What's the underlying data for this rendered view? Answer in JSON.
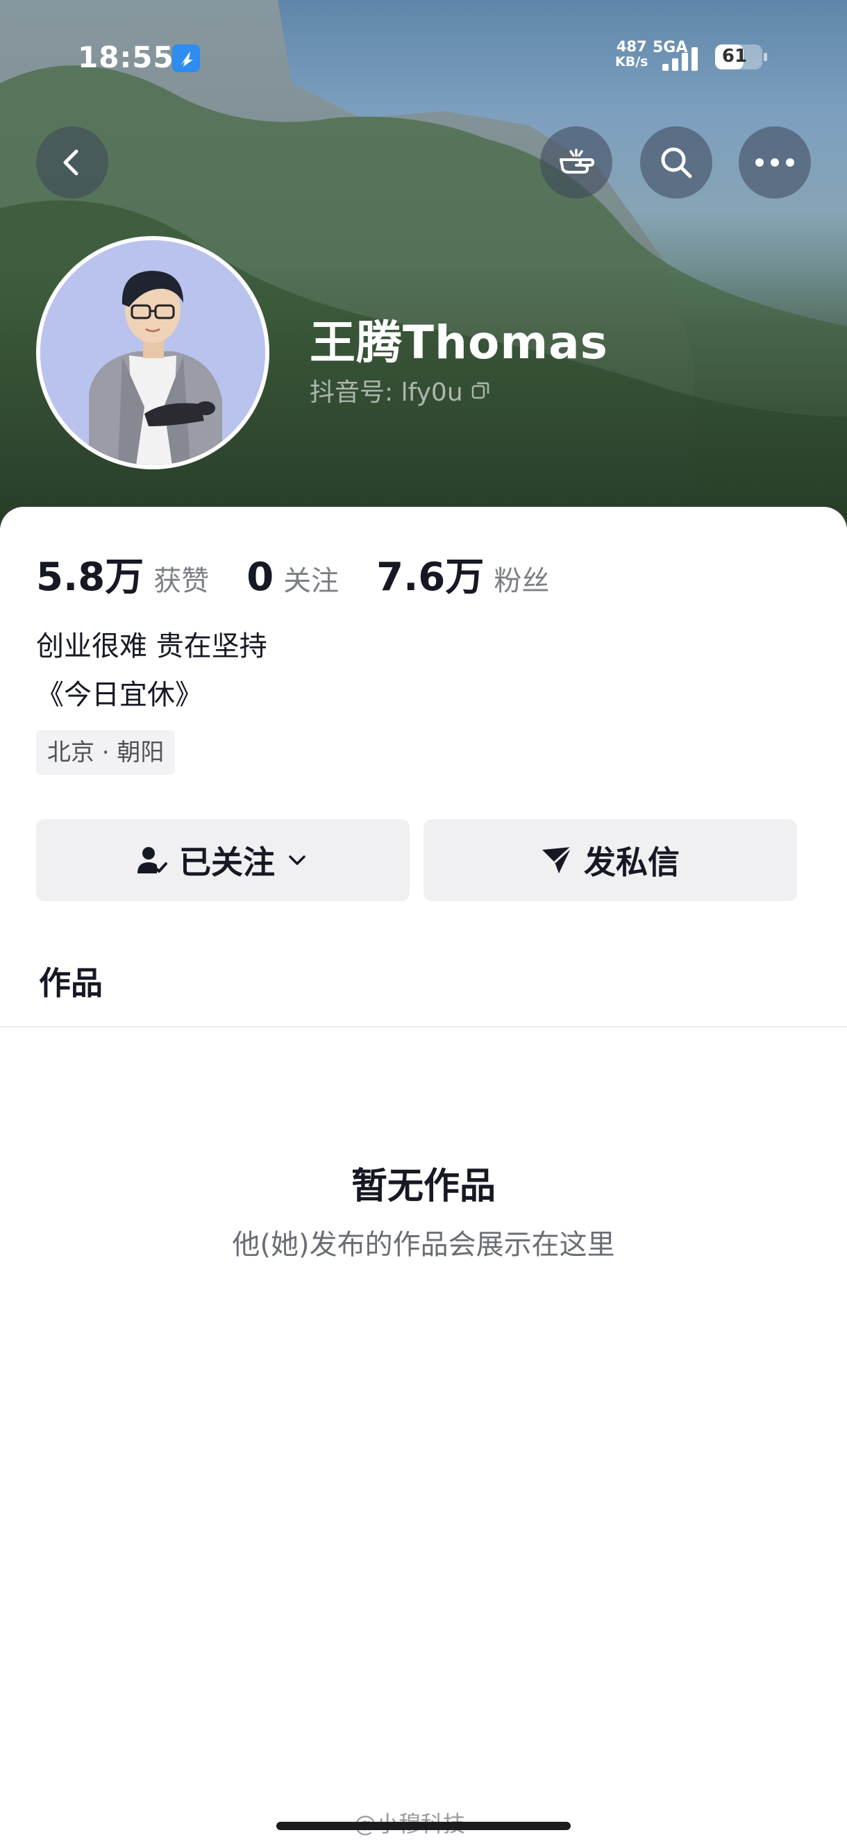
{
  "status_bar": {
    "time": "18:55",
    "net_speed": "487",
    "net_unit": "KB/s",
    "network_type": "5GA",
    "battery": "61",
    "battery_level": 0.61
  },
  "header": {
    "back_icon": "chevron-left-icon",
    "actions": [
      "pointing-hand-icon",
      "search-icon",
      "more-icon"
    ]
  },
  "profile": {
    "name": "王腾Thomas",
    "douyin_id": "抖音号: lfy0u",
    "stats": [
      {
        "value": "5.8万",
        "label": "获赞"
      },
      {
        "value": "0",
        "label": "关注"
      },
      {
        "value": "7.6万",
        "label": "粉丝"
      }
    ],
    "bio_line1": "创业很难 贵在坚持",
    "bio_line2": "《今日宜休》",
    "location": "北京 · 朝阳"
  },
  "actions": {
    "follow_label": "已关注",
    "message_label": "发私信"
  },
  "tabs": {
    "works": "作品"
  },
  "empty_state": {
    "title": "暂无作品",
    "description": "他(她)发布的作品会展示在这里"
  },
  "watermark": "@小穆科技",
  "colors": {
    "text_primary": "#161823",
    "text_secondary": "#7d7f86",
    "button_bg": "#f0f0f2"
  }
}
